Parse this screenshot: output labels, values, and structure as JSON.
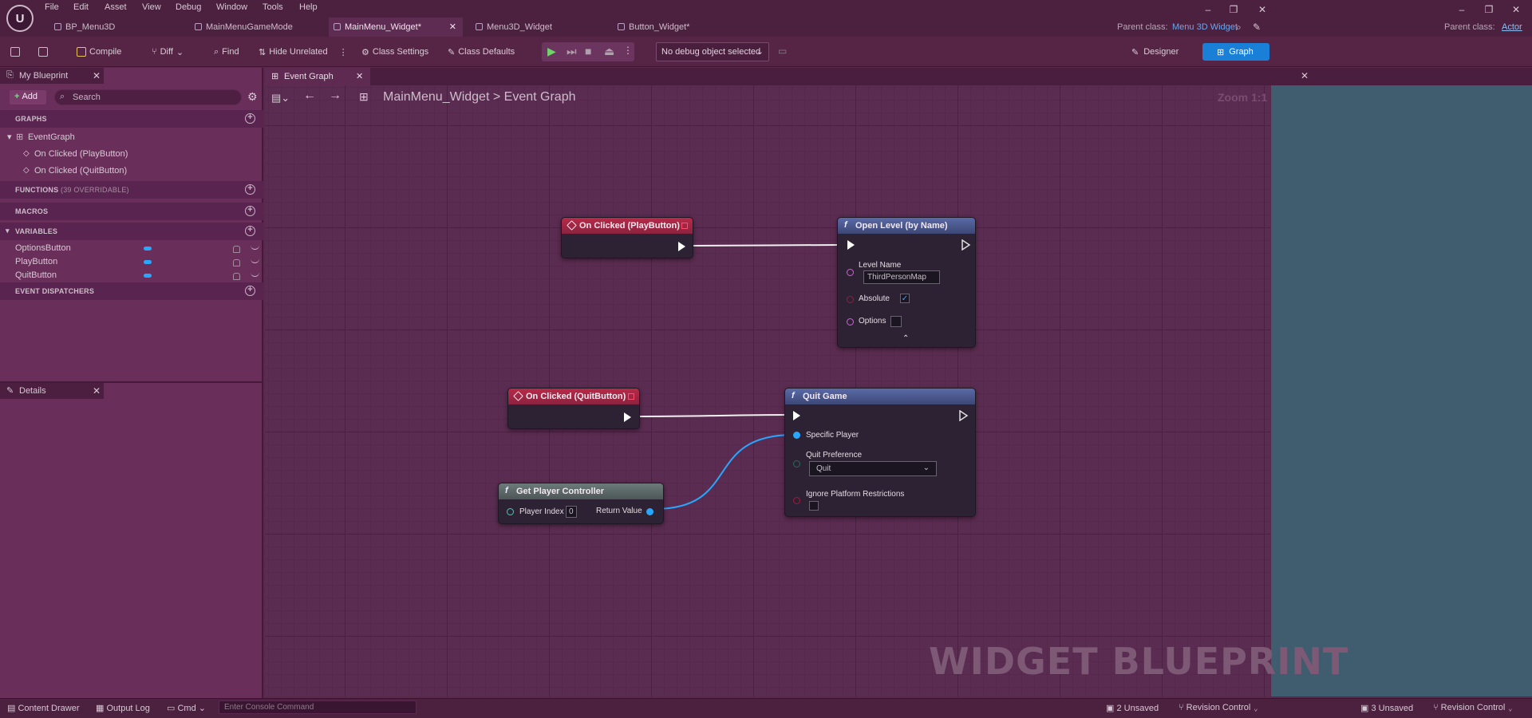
{
  "menu": [
    "File",
    "Edit",
    "Asset",
    "View",
    "Debug",
    "Window",
    "Tools",
    "Help"
  ],
  "tabs": [
    {
      "label": "BP_Menu3D",
      "active": false
    },
    {
      "label": "MainMenuGameMode",
      "active": false
    },
    {
      "label": "MainMenu_Widget*",
      "active": true
    },
    {
      "label": "Menu3D_Widget",
      "active": false
    },
    {
      "label": "Button_Widget*",
      "active": false
    }
  ],
  "parent_class_left": {
    "label": "Parent class:",
    "value": "Menu 3D Widget"
  },
  "parent_class_right": {
    "label": "Parent class:",
    "value": "Actor"
  },
  "toolbar": {
    "compile": "Compile",
    "diff": "Diff",
    "find": "Find",
    "hide_unrelated": "Hide Unrelated",
    "class_settings": "Class Settings",
    "class_defaults": "Class Defaults",
    "debug_select": "No debug object selected",
    "designer": "Designer",
    "graph": "Graph"
  },
  "my_blueprint": {
    "tab_label": "My Blueprint",
    "add_label": "Add",
    "search_placeholder": "Search",
    "graphs_header": "GRAPHS",
    "graphs": [
      "EventGraph",
      "On Clicked (PlayButton)",
      "On Clicked (QuitButton)"
    ],
    "functions_header": "FUNCTIONS",
    "functions_count": "(39 OVERRIDABLE)",
    "macros_header": "MACROS",
    "variables_header": "VARIABLES",
    "variables": [
      "OptionsButton",
      "PlayButton",
      "QuitButton"
    ],
    "dispatchers_header": "EVENT DISPATCHERS"
  },
  "details": {
    "tab_label": "Details"
  },
  "graph": {
    "tab_label": "Event Graph",
    "breadcrumb_root": "MainMenu_Widget",
    "breadcrumb_sep": ">",
    "breadcrumb_leaf": "Event Graph",
    "zoom": "Zoom 1:1",
    "watermark": "WIDGET BLUEPRINT"
  },
  "nodes": {
    "on_clicked_play": {
      "title": "On Clicked (PlayButton)"
    },
    "open_level": {
      "title": "Open Level (by Name)",
      "level_name_label": "Level Name",
      "level_name_value": "ThirdPersonMap",
      "absolute_label": "Absolute",
      "absolute_checked": true,
      "options_label": "Options"
    },
    "on_clicked_quit": {
      "title": "On Clicked (QuitButton)"
    },
    "quit_game": {
      "title": "Quit Game",
      "specific_player_label": "Specific Player",
      "quit_preference_label": "Quit Preference",
      "quit_preference_value": "Quit",
      "ignore_platform_label": "Ignore Platform Restrictions"
    },
    "get_player_controller": {
      "title": "Get Player Controller",
      "player_index_label": "Player Index",
      "player_index_value": "0",
      "return_value_label": "Return Value"
    }
  },
  "statusbar": {
    "content_drawer": "Content Drawer",
    "output_log": "Output Log",
    "cmd": "Cmd",
    "console_placeholder": "Enter Console Command",
    "unsaved_left": "2 Unsaved",
    "revision_left": "Revision Control",
    "unsaved_right": "3 Unsaved",
    "revision_right": "Revision Control"
  },
  "colors": {
    "object_pin": "#29a7ff",
    "exec_pin": "#ffffff",
    "event_header": "#b72a48",
    "function_header": "#5a6aa8",
    "graph_button": "#1a7fd6"
  }
}
